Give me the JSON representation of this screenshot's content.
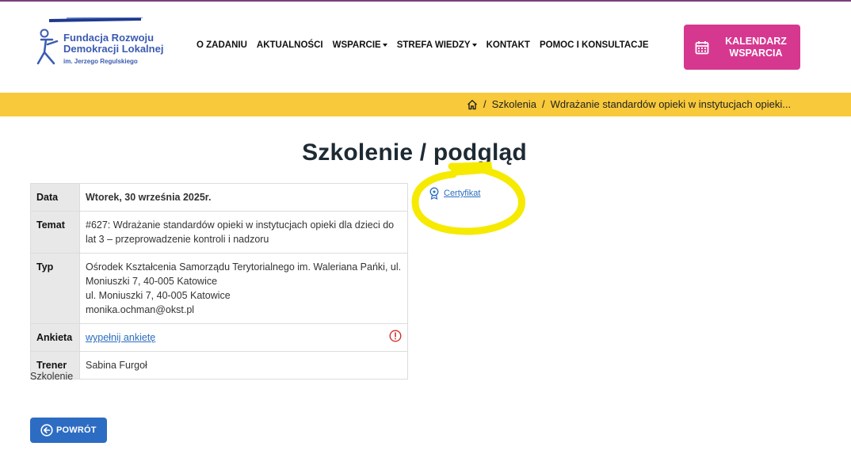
{
  "logo": {
    "line1": "Fundacja Rozwoju",
    "line2": "Demokracji Lokalnej",
    "line3": "im. Jerzego Regulskiego"
  },
  "nav": {
    "items": [
      {
        "label": "O ZADANIU",
        "dropdown": false
      },
      {
        "label": "AKTUALNOŚCI",
        "dropdown": false
      },
      {
        "label": "WSPARCIE",
        "dropdown": true
      },
      {
        "label": "STREFA WIEDZY",
        "dropdown": true
      },
      {
        "label": "KONTAKT",
        "dropdown": false
      },
      {
        "label": "POMOC I KONSULTACJE",
        "dropdown": false
      }
    ]
  },
  "calendar_button": {
    "label_line1": "KALENDARZ",
    "label_line2": "WSPARCIA",
    "icon": "calendar-icon",
    "color": "#d63890"
  },
  "breadcrumb": {
    "home_icon": "home-icon",
    "items": [
      "Szkolenia",
      "Wdrażanie standardów opieki w instytucjach opieki..."
    ],
    "bar_color": "#f8c93a"
  },
  "page": {
    "title": "Szkolenie / podgląd"
  },
  "details": {
    "date_label": "Data",
    "date_value": "Wtorek, 30 września 2025r.",
    "topic_label": "Temat",
    "topic_value": "#627: Wdrażanie standardów opieki w instytucjach opieki dla dzieci do lat 3 – przeprowadzenie kontroli i nadzoru",
    "type_label": "Typ",
    "type_line1": "Ośrodek Kształcenia Samorządu Terytorialnego im. Waleriana Pańki, ul. Moniuszki 7, 40-005 Katowice",
    "type_line2": "ul. Moniuszki 7, 40-005 Katowice",
    "type_line3": "monika.ochman@okst.pl",
    "survey_label": "Ankieta",
    "survey_link": "wypełnij ankietę",
    "survey_icon": "alert-circle-icon",
    "trainer_label": "Trener",
    "trainer_value": "Sabina Furgoł"
  },
  "certificate": {
    "label": "Certyfikat",
    "icon": "certificate-icon"
  },
  "footer": {
    "text": "Szkolenie"
  },
  "back_button": {
    "label": "POWRÓT",
    "icon": "arrow-left-circle-icon",
    "color": "#2d6cc3"
  },
  "colors": {
    "accent_pink": "#d63890",
    "accent_yellow": "#f8c93a",
    "link_blue": "#2a6dbf",
    "highlight_yellow": "#f5ea00"
  }
}
